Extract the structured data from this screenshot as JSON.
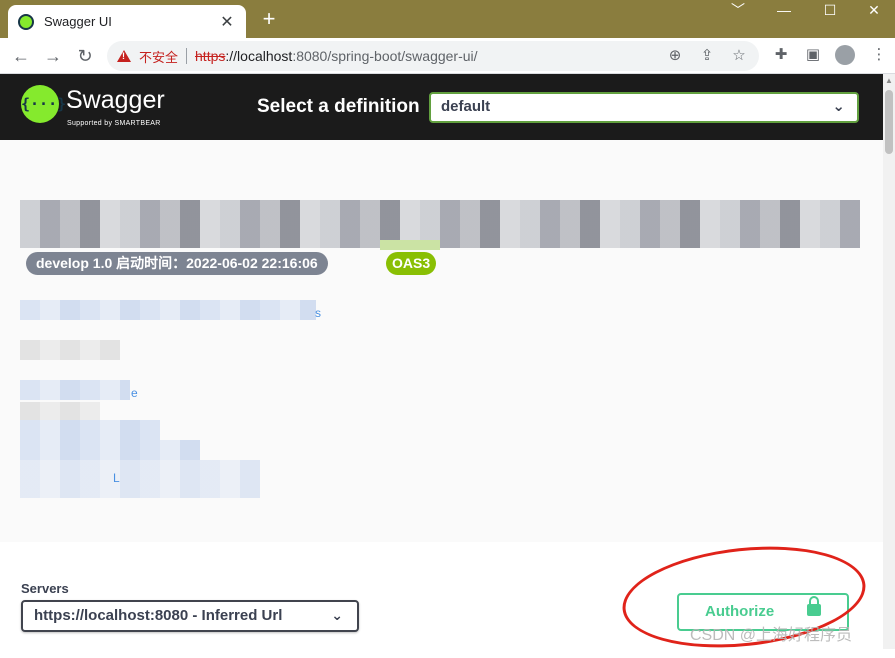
{
  "browser": {
    "tab_title": "Swagger UI",
    "tab_close": "✕",
    "new_tab": "+",
    "window_controls": [
      "﹀",
      "—",
      "☐",
      "✕"
    ],
    "insecure_label": "不安全",
    "url_scheme": "https",
    "url_host": "://localhost",
    "url_path": ":8080/spring-boot/swagger-ui/"
  },
  "topbar": {
    "logo_glyph": "{···}",
    "logo_text": "Swagger",
    "logo_sub": "Supported by SMARTBEAR",
    "select_label": "Select a definition",
    "select_value": "default",
    "chevron": "⌄"
  },
  "info": {
    "version_badge": "develop 1.0  启动时间：2022-06-02 22:16:06",
    "oas_badge": "OAS3",
    "link_tail_1": "s",
    "link_tail_2": "e",
    "link_tail_3": "L"
  },
  "servers": {
    "label": "Servers",
    "selected": "https://localhost:8080 - Inferred Url",
    "chevron": "⌄"
  },
  "authorize": {
    "label": "Authorize"
  },
  "watermark": "CSDN @上海好程序员",
  "colors": {
    "accent_green": "#49cc90",
    "swagger_green": "#85ea2d",
    "oas_badge": "#89bf04",
    "annotation_red": "#e0231a"
  }
}
